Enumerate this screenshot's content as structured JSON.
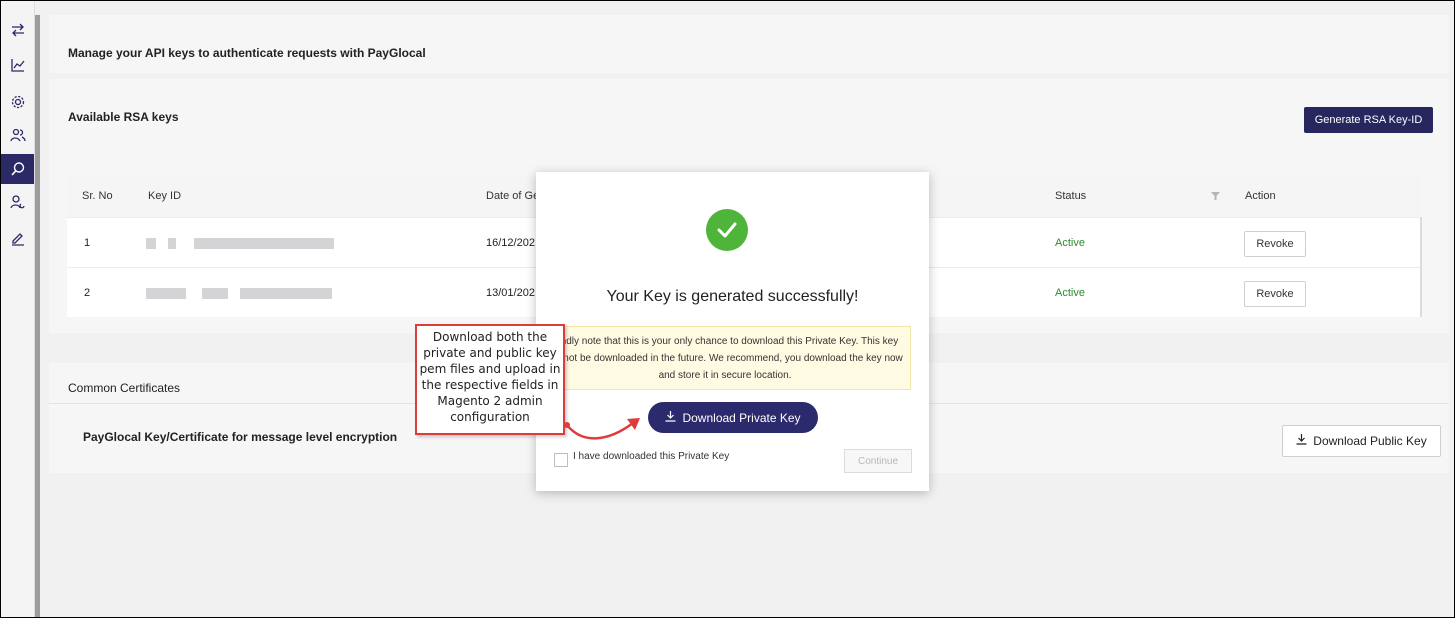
{
  "header": {
    "title": "Manage your API keys to authenticate requests with PayGlocal"
  },
  "rsa": {
    "title": "Available RSA keys",
    "generate_label": "Generate RSA Key-ID",
    "columns": {
      "sr_no": "Sr. No",
      "key_id": "Key ID",
      "date": "Date of Ge",
      "status": "Status",
      "action": "Action"
    },
    "rows": [
      {
        "sr": "1",
        "date": "16/12/202",
        "status": "Active",
        "action": "Revoke"
      },
      {
        "sr": "2",
        "date": "13/01/202",
        "status": "Active",
        "action": "Revoke"
      }
    ]
  },
  "certs": {
    "title": "Common Certificates",
    "item_label": "PayGlocal Key/Certificate for message level encryption",
    "download_public_label": "Download Public Key"
  },
  "modal": {
    "title": "Your Key is generated successfully!",
    "note": "Kindly note that this is your only chance to download this Private Key. This key cannot be downloaded in the future. We recommend, you download the key now and store it in secure location.",
    "download_label": "Download Private Key",
    "checkbox_label": "I have downloaded this Private Key",
    "continue_label": "Continue"
  },
  "callout": {
    "text": "Download both the private and public key pem files and upload in the respective fields in Magento 2 admin configuration"
  },
  "colors": {
    "accent": "#27265e",
    "success": "#4fb43a",
    "annotation": "#e03b3b"
  },
  "icons": [
    "collapse-icon",
    "chart-icon",
    "settings-icon",
    "users-icon",
    "search-icon",
    "user-icon",
    "edit-icon",
    "check-icon",
    "download-icon",
    "filter-icon",
    "arrow-icon"
  ]
}
